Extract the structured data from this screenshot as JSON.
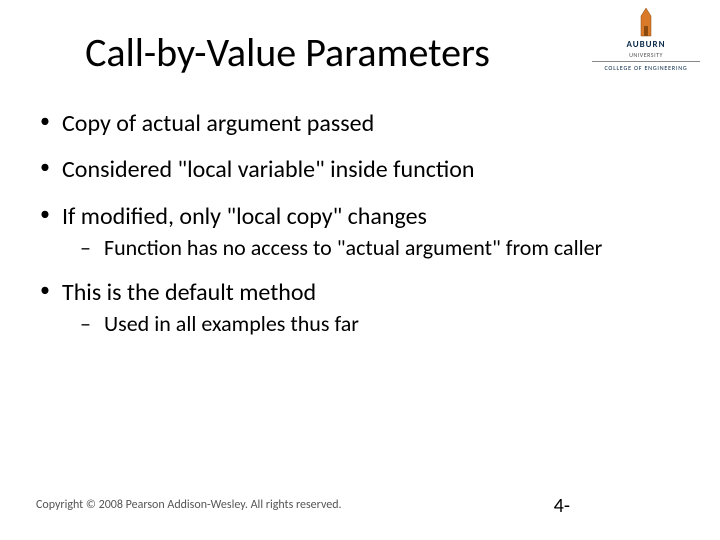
{
  "title": "Call-by-Value Parameters",
  "logo": {
    "uni": "AUBURN",
    "sub": "UNIVERSITY",
    "college": "COLLEGE OF ENGINEERING"
  },
  "bullets": {
    "b1": "Copy of actual argument passed",
    "b2": "Considered \"local variable\" inside function",
    "b3": "If modified, only \"local copy\" changes",
    "b3s1": "Function has no access to \"actual argument\" from caller",
    "b4": "This is the default method",
    "b4s1": "Used in all examples thus far"
  },
  "footer": {
    "copyright": "Copyright © 2008 Pearson Addison-Wesley. All rights reserved.",
    "page": "4-"
  }
}
